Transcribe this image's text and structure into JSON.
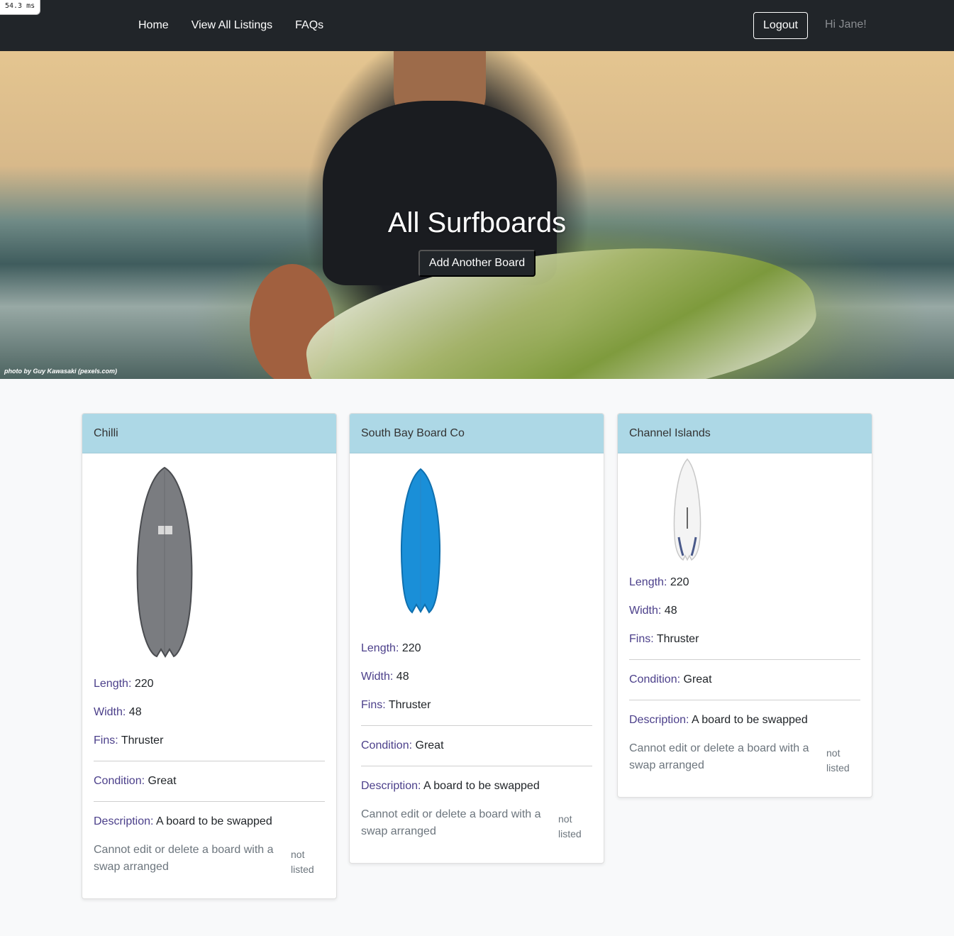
{
  "timing": "54.3 ms",
  "nav": {
    "links": [
      "Home",
      "View All Listings",
      "FAQs"
    ],
    "logout": "Logout",
    "greeting": "Hi Jane!"
  },
  "hero": {
    "title": "All Surfboards",
    "button": "Add Another Board",
    "credit": "photo by Guy Kawasaki (pexels.com)"
  },
  "labels": {
    "length": "Length:",
    "width": "Width:",
    "fins": "Fins:",
    "condition": "Condition:",
    "description": "Description:"
  },
  "boards": [
    {
      "name": "Chilli",
      "length": "220",
      "width": "48",
      "fins": "Thruster",
      "condition": "Great",
      "description": "A board to be swapped",
      "notice": "Cannot edit or delete a board with a swap arranged",
      "status": "not listed",
      "color": "#7a7c80"
    },
    {
      "name": "South Bay Board Co",
      "length": "220",
      "width": "48",
      "fins": "Thruster",
      "condition": "Great",
      "description": "A board to be swapped",
      "notice": "Cannot edit or delete a board with a swap arranged",
      "status": "not listed",
      "color": "#1a8fd8"
    },
    {
      "name": "Channel Islands",
      "length": "220",
      "width": "48",
      "fins": "Thruster",
      "condition": "Great",
      "description": "A board to be swapped",
      "notice": "Cannot edit or delete a board with a swap arranged",
      "status": "not listed",
      "color": "#f4f4f4"
    }
  ]
}
